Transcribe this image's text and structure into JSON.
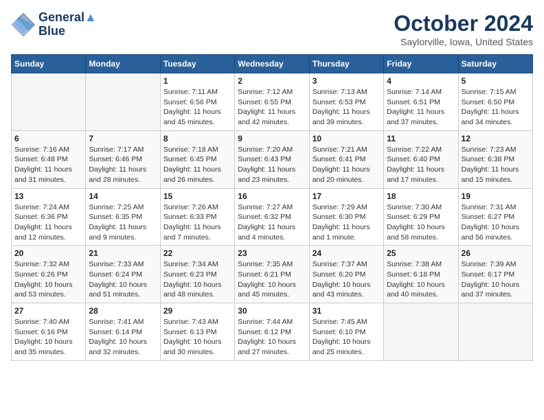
{
  "header": {
    "logo_line1": "General",
    "logo_line2": "Blue",
    "month": "October 2024",
    "location": "Saylorville, Iowa, United States"
  },
  "days_of_week": [
    "Sunday",
    "Monday",
    "Tuesday",
    "Wednesday",
    "Thursday",
    "Friday",
    "Saturday"
  ],
  "weeks": [
    [
      {
        "num": "",
        "info": ""
      },
      {
        "num": "",
        "info": ""
      },
      {
        "num": "1",
        "info": "Sunrise: 7:11 AM\nSunset: 6:56 PM\nDaylight: 11 hours and 45 minutes."
      },
      {
        "num": "2",
        "info": "Sunrise: 7:12 AM\nSunset: 6:55 PM\nDaylight: 11 hours and 42 minutes."
      },
      {
        "num": "3",
        "info": "Sunrise: 7:13 AM\nSunset: 6:53 PM\nDaylight: 11 hours and 39 minutes."
      },
      {
        "num": "4",
        "info": "Sunrise: 7:14 AM\nSunset: 6:51 PM\nDaylight: 11 hours and 37 minutes."
      },
      {
        "num": "5",
        "info": "Sunrise: 7:15 AM\nSunset: 6:50 PM\nDaylight: 11 hours and 34 minutes."
      }
    ],
    [
      {
        "num": "6",
        "info": "Sunrise: 7:16 AM\nSunset: 6:48 PM\nDaylight: 11 hours and 31 minutes."
      },
      {
        "num": "7",
        "info": "Sunrise: 7:17 AM\nSunset: 6:46 PM\nDaylight: 11 hours and 28 minutes."
      },
      {
        "num": "8",
        "info": "Sunrise: 7:18 AM\nSunset: 6:45 PM\nDaylight: 11 hours and 26 minutes."
      },
      {
        "num": "9",
        "info": "Sunrise: 7:20 AM\nSunset: 6:43 PM\nDaylight: 11 hours and 23 minutes."
      },
      {
        "num": "10",
        "info": "Sunrise: 7:21 AM\nSunset: 6:41 PM\nDaylight: 11 hours and 20 minutes."
      },
      {
        "num": "11",
        "info": "Sunrise: 7:22 AM\nSunset: 6:40 PM\nDaylight: 11 hours and 17 minutes."
      },
      {
        "num": "12",
        "info": "Sunrise: 7:23 AM\nSunset: 6:38 PM\nDaylight: 11 hours and 15 minutes."
      }
    ],
    [
      {
        "num": "13",
        "info": "Sunrise: 7:24 AM\nSunset: 6:36 PM\nDaylight: 11 hours and 12 minutes."
      },
      {
        "num": "14",
        "info": "Sunrise: 7:25 AM\nSunset: 6:35 PM\nDaylight: 11 hours and 9 minutes."
      },
      {
        "num": "15",
        "info": "Sunrise: 7:26 AM\nSunset: 6:33 PM\nDaylight: 11 hours and 7 minutes."
      },
      {
        "num": "16",
        "info": "Sunrise: 7:27 AM\nSunset: 6:32 PM\nDaylight: 11 hours and 4 minutes."
      },
      {
        "num": "17",
        "info": "Sunrise: 7:29 AM\nSunset: 6:30 PM\nDaylight: 11 hours and 1 minute."
      },
      {
        "num": "18",
        "info": "Sunrise: 7:30 AM\nSunset: 6:29 PM\nDaylight: 10 hours and 58 minutes."
      },
      {
        "num": "19",
        "info": "Sunrise: 7:31 AM\nSunset: 6:27 PM\nDaylight: 10 hours and 56 minutes."
      }
    ],
    [
      {
        "num": "20",
        "info": "Sunrise: 7:32 AM\nSunset: 6:26 PM\nDaylight: 10 hours and 53 minutes."
      },
      {
        "num": "21",
        "info": "Sunrise: 7:33 AM\nSunset: 6:24 PM\nDaylight: 10 hours and 51 minutes."
      },
      {
        "num": "22",
        "info": "Sunrise: 7:34 AM\nSunset: 6:23 PM\nDaylight: 10 hours and 48 minutes."
      },
      {
        "num": "23",
        "info": "Sunrise: 7:35 AM\nSunset: 6:21 PM\nDaylight: 10 hours and 45 minutes."
      },
      {
        "num": "24",
        "info": "Sunrise: 7:37 AM\nSunset: 6:20 PM\nDaylight: 10 hours and 43 minutes."
      },
      {
        "num": "25",
        "info": "Sunrise: 7:38 AM\nSunset: 6:18 PM\nDaylight: 10 hours and 40 minutes."
      },
      {
        "num": "26",
        "info": "Sunrise: 7:39 AM\nSunset: 6:17 PM\nDaylight: 10 hours and 37 minutes."
      }
    ],
    [
      {
        "num": "27",
        "info": "Sunrise: 7:40 AM\nSunset: 6:16 PM\nDaylight: 10 hours and 35 minutes."
      },
      {
        "num": "28",
        "info": "Sunrise: 7:41 AM\nSunset: 6:14 PM\nDaylight: 10 hours and 32 minutes."
      },
      {
        "num": "29",
        "info": "Sunrise: 7:43 AM\nSunset: 6:13 PM\nDaylight: 10 hours and 30 minutes."
      },
      {
        "num": "30",
        "info": "Sunrise: 7:44 AM\nSunset: 6:12 PM\nDaylight: 10 hours and 27 minutes."
      },
      {
        "num": "31",
        "info": "Sunrise: 7:45 AM\nSunset: 6:10 PM\nDaylight: 10 hours and 25 minutes."
      },
      {
        "num": "",
        "info": ""
      },
      {
        "num": "",
        "info": ""
      }
    ]
  ]
}
